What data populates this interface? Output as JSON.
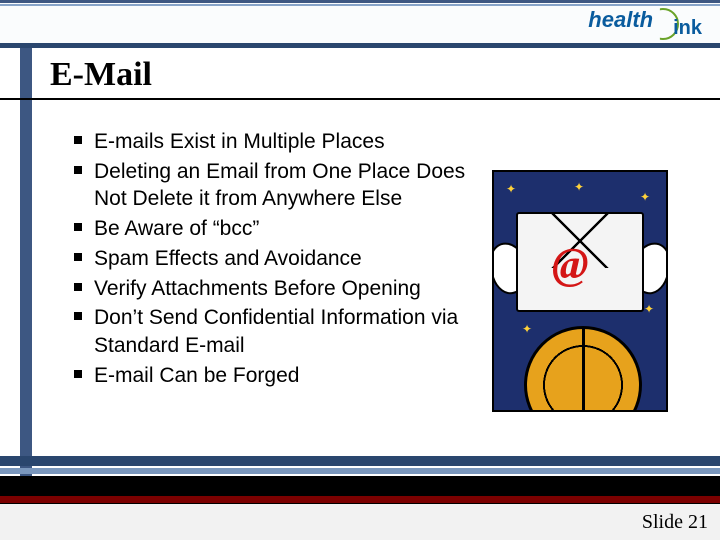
{
  "logo": {
    "health": "health",
    "link": "ink"
  },
  "title": "E-Mail",
  "bullets": [
    "E-mails Exist in Multiple Places",
    "Deleting an Email from One Place Does Not Delete it from Anywhere Else",
    "Be Aware of “bcc”",
    "Spam Effects and Avoidance",
    "Verify Attachments Before Opening",
    "Don’t Send Confidential Information via Standard E-mail",
    "E-mail Can be Forged"
  ],
  "clipart": {
    "at_symbol": "@"
  },
  "footer": {
    "slide_label": "Slide  21"
  }
}
